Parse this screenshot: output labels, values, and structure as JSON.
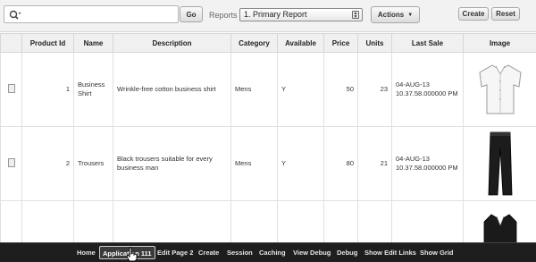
{
  "toolbar": {
    "search_value": "",
    "go_label": "Go",
    "reports_label": "Reports",
    "report_selected": "1. Primary Report",
    "actions_label": "Actions",
    "create_label": "Create",
    "reset_label": "Reset"
  },
  "table": {
    "columns": [
      "Product Id",
      "Name",
      "Description",
      "Category",
      "Available",
      "Price",
      "Units",
      "Last Sale",
      "Image"
    ],
    "rows": [
      {
        "product_id": "1",
        "name": "Business Shirt",
        "description": "Wrinkle-free cotton business shirt",
        "category": "Mens",
        "available": "Y",
        "price": "50",
        "units": "23",
        "last_sale": "04-AUG-13 10.37.58.000000 PM",
        "image": "white-business-shirt"
      },
      {
        "product_id": "2",
        "name": "Trousers",
        "description": "Black trousers suitable for every business man",
        "category": "Mens",
        "available": "Y",
        "price": "80",
        "units": "21",
        "last_sale": "04-AUG-13 10.37.58.000000 PM",
        "image": "black-trousers"
      },
      {
        "image": "black-jacket"
      }
    ]
  },
  "devbar": {
    "items": [
      "Home",
      "Application 111",
      "Edit Page 2",
      "Create",
      "Session",
      "Caching",
      "View Debug",
      "Debug",
      "Show Edit Links",
      "Show Grid"
    ],
    "active": "Application 111"
  },
  "colors": {
    "devbar_bg": "#1e1e1e",
    "toolbar_bg": "#f2f2f2"
  },
  "icons": {
    "search": "search-icon",
    "row_edit": "document-icon",
    "cursor": "hand-cursor-icon"
  }
}
